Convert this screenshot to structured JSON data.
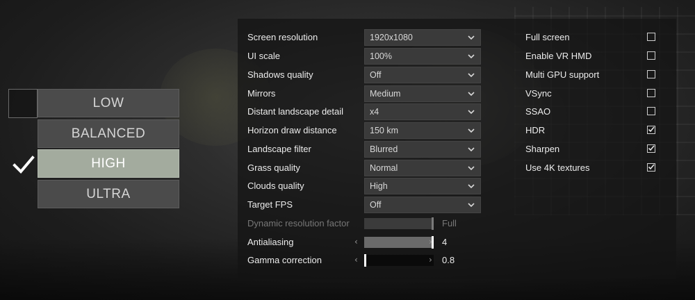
{
  "presets": {
    "items": [
      {
        "label": "LOW",
        "active": false
      },
      {
        "label": "BALANCED",
        "active": false
      },
      {
        "label": "HIGH",
        "active": true
      },
      {
        "label": "ULTRA",
        "active": false
      }
    ],
    "selected_icon": "checkmark-icon"
  },
  "settings": {
    "dropdowns": [
      {
        "label": "Screen resolution",
        "value": "1920x1080"
      },
      {
        "label": "UI scale",
        "value": "100%"
      },
      {
        "label": "Shadows quality",
        "value": "Off"
      },
      {
        "label": "Mirrors",
        "value": "Medium"
      },
      {
        "label": "Distant landscape detail",
        "value": "x4"
      },
      {
        "label": "Horizon draw distance",
        "value": "150 km"
      },
      {
        "label": "Landscape filter",
        "value": "Blurred"
      },
      {
        "label": "Grass quality",
        "value": "Normal"
      },
      {
        "label": "Clouds quality",
        "value": "High"
      },
      {
        "label": "Target FPS",
        "value": "Off"
      }
    ],
    "sliders": [
      {
        "label": "Dynamic resolution factor",
        "value": "Full",
        "level": 1.0,
        "disabled": true
      },
      {
        "label": "Antialiasing",
        "value": "4",
        "level": 1.0,
        "disabled": false
      },
      {
        "label": "Gamma correction",
        "value": "0.8",
        "level": 0.0,
        "disabled": false
      }
    ],
    "toggles": [
      {
        "label": "Full screen",
        "checked": false
      },
      {
        "label": "Enable VR HMD",
        "checked": false
      },
      {
        "label": "Multi GPU support",
        "checked": false
      },
      {
        "label": "VSync",
        "checked": false
      },
      {
        "label": "SSAO",
        "checked": false
      },
      {
        "label": "HDR",
        "checked": true
      },
      {
        "label": "Sharpen",
        "checked": true
      },
      {
        "label": "Use 4K textures",
        "checked": true
      }
    ]
  },
  "colors": {
    "active_preset": "#a3ab9e",
    "preset": "#4b4b4b",
    "panel": "#141414"
  }
}
